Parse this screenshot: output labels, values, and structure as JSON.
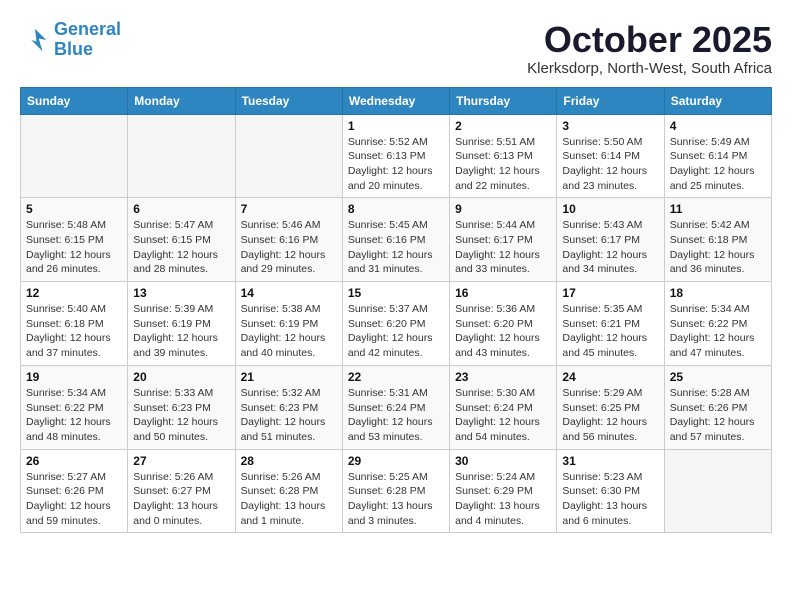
{
  "logo": {
    "line1": "General",
    "line2": "Blue"
  },
  "title": "October 2025",
  "location": "Klerksdorp, North-West, South Africa",
  "weekdays": [
    "Sunday",
    "Monday",
    "Tuesday",
    "Wednesday",
    "Thursday",
    "Friday",
    "Saturday"
  ],
  "weeks": [
    [
      {
        "day": "",
        "info": ""
      },
      {
        "day": "",
        "info": ""
      },
      {
        "day": "",
        "info": ""
      },
      {
        "day": "1",
        "info": "Sunrise: 5:52 AM\nSunset: 6:13 PM\nDaylight: 12 hours\nand 20 minutes."
      },
      {
        "day": "2",
        "info": "Sunrise: 5:51 AM\nSunset: 6:13 PM\nDaylight: 12 hours\nand 22 minutes."
      },
      {
        "day": "3",
        "info": "Sunrise: 5:50 AM\nSunset: 6:14 PM\nDaylight: 12 hours\nand 23 minutes."
      },
      {
        "day": "4",
        "info": "Sunrise: 5:49 AM\nSunset: 6:14 PM\nDaylight: 12 hours\nand 25 minutes."
      }
    ],
    [
      {
        "day": "5",
        "info": "Sunrise: 5:48 AM\nSunset: 6:15 PM\nDaylight: 12 hours\nand 26 minutes."
      },
      {
        "day": "6",
        "info": "Sunrise: 5:47 AM\nSunset: 6:15 PM\nDaylight: 12 hours\nand 28 minutes."
      },
      {
        "day": "7",
        "info": "Sunrise: 5:46 AM\nSunset: 6:16 PM\nDaylight: 12 hours\nand 29 minutes."
      },
      {
        "day": "8",
        "info": "Sunrise: 5:45 AM\nSunset: 6:16 PM\nDaylight: 12 hours\nand 31 minutes."
      },
      {
        "day": "9",
        "info": "Sunrise: 5:44 AM\nSunset: 6:17 PM\nDaylight: 12 hours\nand 33 minutes."
      },
      {
        "day": "10",
        "info": "Sunrise: 5:43 AM\nSunset: 6:17 PM\nDaylight: 12 hours\nand 34 minutes."
      },
      {
        "day": "11",
        "info": "Sunrise: 5:42 AM\nSunset: 6:18 PM\nDaylight: 12 hours\nand 36 minutes."
      }
    ],
    [
      {
        "day": "12",
        "info": "Sunrise: 5:40 AM\nSunset: 6:18 PM\nDaylight: 12 hours\nand 37 minutes."
      },
      {
        "day": "13",
        "info": "Sunrise: 5:39 AM\nSunset: 6:19 PM\nDaylight: 12 hours\nand 39 minutes."
      },
      {
        "day": "14",
        "info": "Sunrise: 5:38 AM\nSunset: 6:19 PM\nDaylight: 12 hours\nand 40 minutes."
      },
      {
        "day": "15",
        "info": "Sunrise: 5:37 AM\nSunset: 6:20 PM\nDaylight: 12 hours\nand 42 minutes."
      },
      {
        "day": "16",
        "info": "Sunrise: 5:36 AM\nSunset: 6:20 PM\nDaylight: 12 hours\nand 43 minutes."
      },
      {
        "day": "17",
        "info": "Sunrise: 5:35 AM\nSunset: 6:21 PM\nDaylight: 12 hours\nand 45 minutes."
      },
      {
        "day": "18",
        "info": "Sunrise: 5:34 AM\nSunset: 6:22 PM\nDaylight: 12 hours\nand 47 minutes."
      }
    ],
    [
      {
        "day": "19",
        "info": "Sunrise: 5:34 AM\nSunset: 6:22 PM\nDaylight: 12 hours\nand 48 minutes."
      },
      {
        "day": "20",
        "info": "Sunrise: 5:33 AM\nSunset: 6:23 PM\nDaylight: 12 hours\nand 50 minutes."
      },
      {
        "day": "21",
        "info": "Sunrise: 5:32 AM\nSunset: 6:23 PM\nDaylight: 12 hours\nand 51 minutes."
      },
      {
        "day": "22",
        "info": "Sunrise: 5:31 AM\nSunset: 6:24 PM\nDaylight: 12 hours\nand 53 minutes."
      },
      {
        "day": "23",
        "info": "Sunrise: 5:30 AM\nSunset: 6:24 PM\nDaylight: 12 hours\nand 54 minutes."
      },
      {
        "day": "24",
        "info": "Sunrise: 5:29 AM\nSunset: 6:25 PM\nDaylight: 12 hours\nand 56 minutes."
      },
      {
        "day": "25",
        "info": "Sunrise: 5:28 AM\nSunset: 6:26 PM\nDaylight: 12 hours\nand 57 minutes."
      }
    ],
    [
      {
        "day": "26",
        "info": "Sunrise: 5:27 AM\nSunset: 6:26 PM\nDaylight: 12 hours\nand 59 minutes."
      },
      {
        "day": "27",
        "info": "Sunrise: 5:26 AM\nSunset: 6:27 PM\nDaylight: 13 hours\nand 0 minutes."
      },
      {
        "day": "28",
        "info": "Sunrise: 5:26 AM\nSunset: 6:28 PM\nDaylight: 13 hours\nand 1 minute."
      },
      {
        "day": "29",
        "info": "Sunrise: 5:25 AM\nSunset: 6:28 PM\nDaylight: 13 hours\nand 3 minutes."
      },
      {
        "day": "30",
        "info": "Sunrise: 5:24 AM\nSunset: 6:29 PM\nDaylight: 13 hours\nand 4 minutes."
      },
      {
        "day": "31",
        "info": "Sunrise: 5:23 AM\nSunset: 6:30 PM\nDaylight: 13 hours\nand 6 minutes."
      },
      {
        "day": "",
        "info": ""
      }
    ]
  ]
}
